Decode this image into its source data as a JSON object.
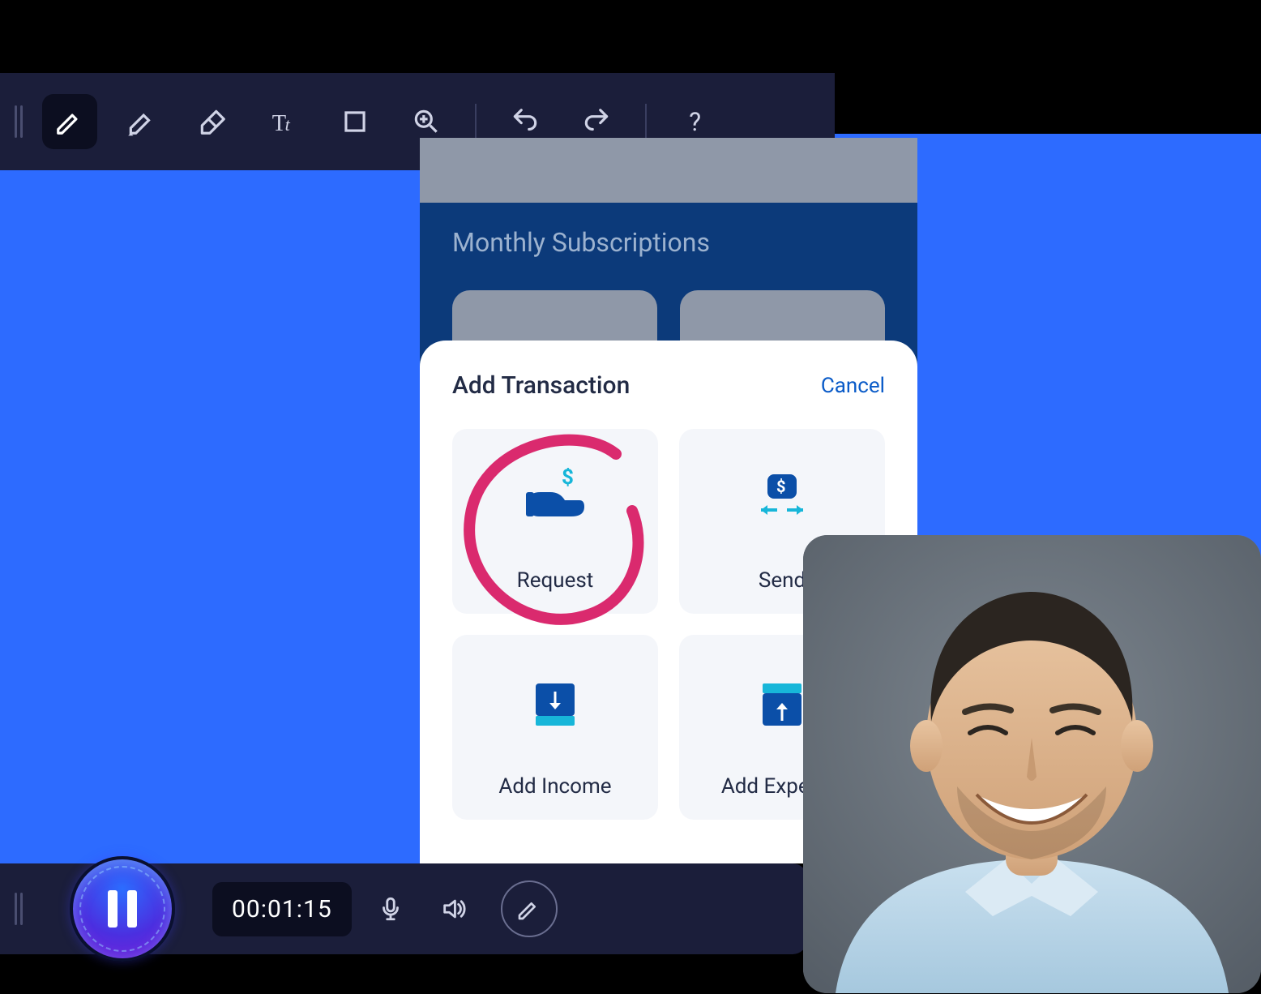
{
  "toolbar": {
    "tools": [
      "pen",
      "highlighter",
      "eraser",
      "text",
      "rectangle",
      "zoom-in"
    ],
    "active_tool": "pen",
    "actions": [
      "undo",
      "redo"
    ],
    "help": "help"
  },
  "app_screen": {
    "section_title": "Monthly Subscriptions",
    "sheet": {
      "title": "Add Transaction",
      "cancel_label": "Cancel",
      "tiles": [
        {
          "icon": "request-money",
          "label": "Request"
        },
        {
          "icon": "send-money",
          "label": "Send"
        },
        {
          "icon": "add-income",
          "label": "Add Income"
        },
        {
          "icon": "add-expense",
          "label": "Add Expense"
        }
      ]
    }
  },
  "annotation": {
    "type": "freehand-circle",
    "color": "#DA2A6E",
    "target": "Request"
  },
  "recording_bar": {
    "state": "recording",
    "timer": "00:01:15",
    "controls": [
      "mic",
      "speaker",
      "pen"
    ]
  },
  "webcam": {
    "present": true,
    "shape": "rounded-square",
    "description": "Smiling person wearing light blue collared shirt"
  }
}
